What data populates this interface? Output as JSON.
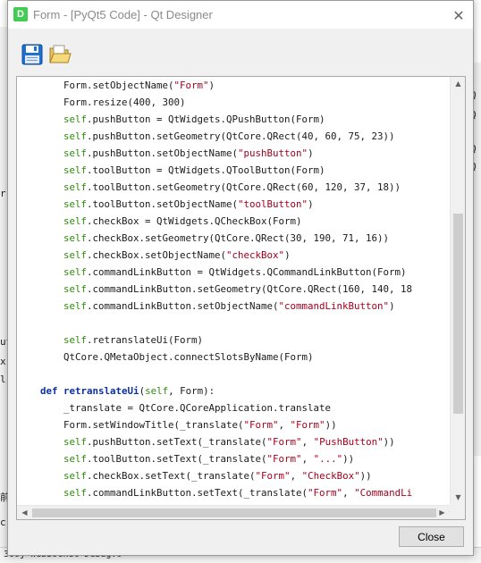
{
  "window": {
    "app_icon_letter": "D",
    "title": "Form - [PyQt5 Code] - Qt Designer",
    "close_glyph": "✕"
  },
  "toolbar": {
    "save_icon": "save-icon",
    "open_icon": "open-folder-icon"
  },
  "code_lines": [
    [
      {
        "t": "        Form.setObjectName(",
        "c": ""
      },
      {
        "t": "\"Form\"",
        "c": "str"
      },
      {
        "t": ")",
        "c": ""
      }
    ],
    [
      {
        "t": "        Form.resize(400, 300)",
        "c": ""
      }
    ],
    [
      {
        "t": "        ",
        "c": ""
      },
      {
        "t": "self",
        "c": "self"
      },
      {
        "t": ".pushButton = QtWidgets.QPushButton(Form)",
        "c": ""
      }
    ],
    [
      {
        "t": "        ",
        "c": ""
      },
      {
        "t": "self",
        "c": "self"
      },
      {
        "t": ".pushButton.setGeometry(QtCore.QRect(40, 60, 75, 23))",
        "c": ""
      }
    ],
    [
      {
        "t": "        ",
        "c": ""
      },
      {
        "t": "self",
        "c": "self"
      },
      {
        "t": ".pushButton.setObjectName(",
        "c": ""
      },
      {
        "t": "\"pushButton\"",
        "c": "str"
      },
      {
        "t": ")",
        "c": ""
      }
    ],
    [
      {
        "t": "        ",
        "c": ""
      },
      {
        "t": "self",
        "c": "self"
      },
      {
        "t": ".toolButton = QtWidgets.QToolButton(Form)",
        "c": ""
      }
    ],
    [
      {
        "t": "        ",
        "c": ""
      },
      {
        "t": "self",
        "c": "self"
      },
      {
        "t": ".toolButton.setGeometry(QtCore.QRect(60, 120, 37, 18))",
        "c": ""
      }
    ],
    [
      {
        "t": "        ",
        "c": ""
      },
      {
        "t": "self",
        "c": "self"
      },
      {
        "t": ".toolButton.setObjectName(",
        "c": ""
      },
      {
        "t": "\"toolButton\"",
        "c": "str"
      },
      {
        "t": ")",
        "c": ""
      }
    ],
    [
      {
        "t": "        ",
        "c": ""
      },
      {
        "t": "self",
        "c": "self"
      },
      {
        "t": ".checkBox = QtWidgets.QCheckBox(Form)",
        "c": ""
      }
    ],
    [
      {
        "t": "        ",
        "c": ""
      },
      {
        "t": "self",
        "c": "self"
      },
      {
        "t": ".checkBox.setGeometry(QtCore.QRect(30, 190, 71, 16))",
        "c": ""
      }
    ],
    [
      {
        "t": "        ",
        "c": ""
      },
      {
        "t": "self",
        "c": "self"
      },
      {
        "t": ".checkBox.setObjectName(",
        "c": ""
      },
      {
        "t": "\"checkBox\"",
        "c": "str"
      },
      {
        "t": ")",
        "c": ""
      }
    ],
    [
      {
        "t": "        ",
        "c": ""
      },
      {
        "t": "self",
        "c": "self"
      },
      {
        "t": ".commandLinkButton = QtWidgets.QCommandLinkButton(Form)",
        "c": ""
      }
    ],
    [
      {
        "t": "        ",
        "c": ""
      },
      {
        "t": "self",
        "c": "self"
      },
      {
        "t": ".commandLinkButton.setGeometry(QtCore.QRect(160, 140, 18",
        "c": ""
      }
    ],
    [
      {
        "t": "        ",
        "c": ""
      },
      {
        "t": "self",
        "c": "self"
      },
      {
        "t": ".commandLinkButton.setObjectName(",
        "c": ""
      },
      {
        "t": "\"commandLinkButton\"",
        "c": "str"
      },
      {
        "t": ")",
        "c": ""
      }
    ],
    [],
    [
      {
        "t": "        ",
        "c": ""
      },
      {
        "t": "self",
        "c": "self"
      },
      {
        "t": ".retranslateUi(Form)",
        "c": ""
      }
    ],
    [
      {
        "t": "        QtCore.QMetaObject.connectSlotsByName(Form)",
        "c": ""
      }
    ],
    [],
    [
      {
        "t": "    ",
        "c": ""
      },
      {
        "t": "def",
        "c": "def"
      },
      {
        "t": " ",
        "c": ""
      },
      {
        "t": "retranslateUi",
        "c": "def"
      },
      {
        "t": "(",
        "c": ""
      },
      {
        "t": "self",
        "c": "self"
      },
      {
        "t": ", Form):",
        "c": ""
      }
    ],
    [
      {
        "t": "        _translate = QtCore.QCoreApplication.translate",
        "c": ""
      }
    ],
    [
      {
        "t": "        Form.setWindowTitle(_translate(",
        "c": ""
      },
      {
        "t": "\"Form\"",
        "c": "str"
      },
      {
        "t": ", ",
        "c": ""
      },
      {
        "t": "\"Form\"",
        "c": "str"
      },
      {
        "t": "))",
        "c": ""
      }
    ],
    [
      {
        "t": "        ",
        "c": ""
      },
      {
        "t": "self",
        "c": "self"
      },
      {
        "t": ".pushButton.setText(_translate(",
        "c": ""
      },
      {
        "t": "\"Form\"",
        "c": "str"
      },
      {
        "t": ", ",
        "c": ""
      },
      {
        "t": "\"PushButton\"",
        "c": "str"
      },
      {
        "t": "))",
        "c": ""
      }
    ],
    [
      {
        "t": "        ",
        "c": ""
      },
      {
        "t": "self",
        "c": "self"
      },
      {
        "t": ".toolButton.setText(_translate(",
        "c": ""
      },
      {
        "t": "\"Form\"",
        "c": "str"
      },
      {
        "t": ", ",
        "c": ""
      },
      {
        "t": "\"...\"",
        "c": "str"
      },
      {
        "t": "))",
        "c": ""
      }
    ],
    [
      {
        "t": "        ",
        "c": ""
      },
      {
        "t": "self",
        "c": "self"
      },
      {
        "t": ".checkBox.setText(_translate(",
        "c": ""
      },
      {
        "t": "\"Form\"",
        "c": "str"
      },
      {
        "t": ", ",
        "c": ""
      },
      {
        "t": "\"CheckBox\"",
        "c": "str"
      },
      {
        "t": "))",
        "c": ""
      }
    ],
    [
      {
        "t": "        ",
        "c": ""
      },
      {
        "t": "self",
        "c": "self"
      },
      {
        "t": ".commandLinkButton.setText(_translate(",
        "c": ""
      },
      {
        "t": "\"Form\"",
        "c": "str"
      },
      {
        "t": ", ",
        "c": ""
      },
      {
        "t": "\"CommandLi",
        "c": "str"
      }
    ]
  ],
  "scrollbars": {
    "up_arrow": "▲",
    "down_arrow": "▼",
    "left_arrow": "◀",
    "right_arrow": "▶"
  },
  "buttons": {
    "close_label": "Close"
  },
  "background": {
    "bottom_text": "3ooj WebSocket Debug.0",
    "right_fragments": [
      "Q",
      "Q",
      "Q",
      "Q"
    ],
    "left_fragments": [
      "r",
      "ut",
      "x",
      "l-",
      "前",
      "c"
    ]
  },
  "colors": {
    "self_keyword": "#2e8b0b",
    "string": "#a4001d",
    "def_keyword": "#0b2fa8",
    "qt_green": "#41cd52"
  }
}
